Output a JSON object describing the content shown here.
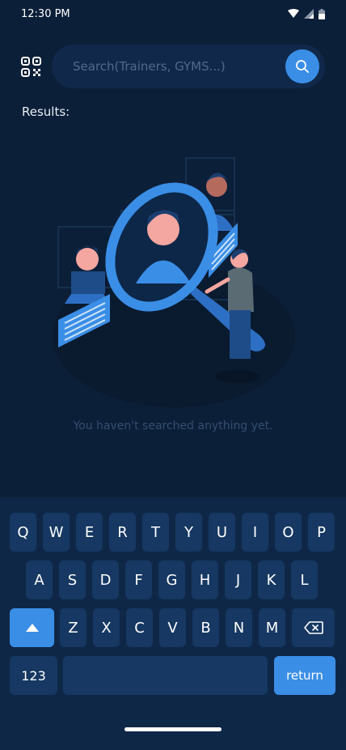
{
  "status_bar": {
    "time": "12:30 PM"
  },
  "search": {
    "placeholder": "Search(Trainers, GYMS...)",
    "value": ""
  },
  "results": {
    "label": "Results:"
  },
  "empty_state": {
    "message": "You haven't searched anything yet."
  },
  "keyboard": {
    "row1": [
      "Q",
      "W",
      "E",
      "R",
      "T",
      "Y",
      "U",
      "I",
      "O",
      "P"
    ],
    "row2": [
      "A",
      "S",
      "D",
      "F",
      "G",
      "H",
      "J",
      "K",
      "L"
    ],
    "row3": [
      "Z",
      "X",
      "C",
      "V",
      "B",
      "N",
      "M"
    ],
    "numbers_label": "123",
    "return_label": "return"
  },
  "icons": {
    "qr": "qr-code-icon",
    "search": "search-icon",
    "shift": "shift-icon",
    "backspace": "backspace-icon",
    "wifi": "wifi-icon",
    "signal": "signal-icon",
    "battery": "battery-icon"
  },
  "colors": {
    "background": "#0c1f38",
    "search_field": "#10294a",
    "accent": "#3a8ee6",
    "keyboard": "#0f2747",
    "key": "#163862"
  }
}
